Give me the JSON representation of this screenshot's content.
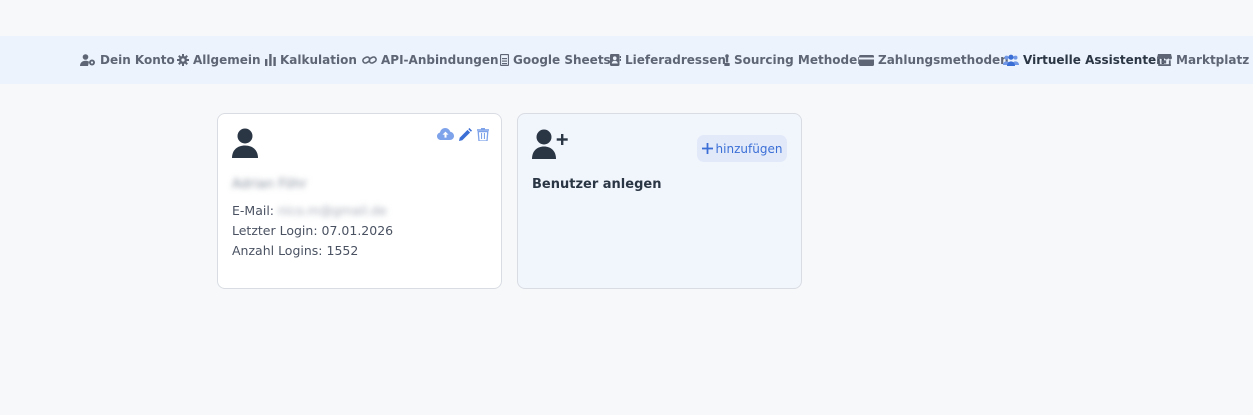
{
  "nav": {
    "items": [
      {
        "label": "Dein Konto",
        "icon": "user-gear-icon"
      },
      {
        "label": "Allgemein",
        "icon": "gear-icon"
      },
      {
        "label": "Kalkulation",
        "icon": "bar-chart-icon"
      },
      {
        "label": "API-Anbindungen",
        "icon": "link-icon"
      },
      {
        "label": "Google Sheets",
        "icon": "spreadsheet-icon"
      },
      {
        "label": "Lieferadressen",
        "icon": "address-book-icon"
      },
      {
        "label": "Sourcing Methoden",
        "icon": "chess-piece-icon"
      },
      {
        "label": "Zahlungsmethoden",
        "icon": "credit-card-icon"
      },
      {
        "label": "Virtuelle Assistenten",
        "icon": "users-icon",
        "active": true
      },
      {
        "label": "Marktplatz",
        "icon": "store-icon"
      }
    ],
    "active_color": "#3c6fd6"
  },
  "user_card": {
    "name": "Adrian Föhr",
    "email_label": "E-Mail:",
    "email_value": "nico.m@gmail.de",
    "last_login_label": "Letzter Login:",
    "last_login_value": "07.01.2026",
    "logins_label": "Anzahl Logins:",
    "logins_value": "1552",
    "actions": [
      "cloud-upload-icon",
      "pencil-icon",
      "trash-icon"
    ]
  },
  "add_card": {
    "button_label": "hinzufügen",
    "title": "Benutzer anlegen"
  }
}
